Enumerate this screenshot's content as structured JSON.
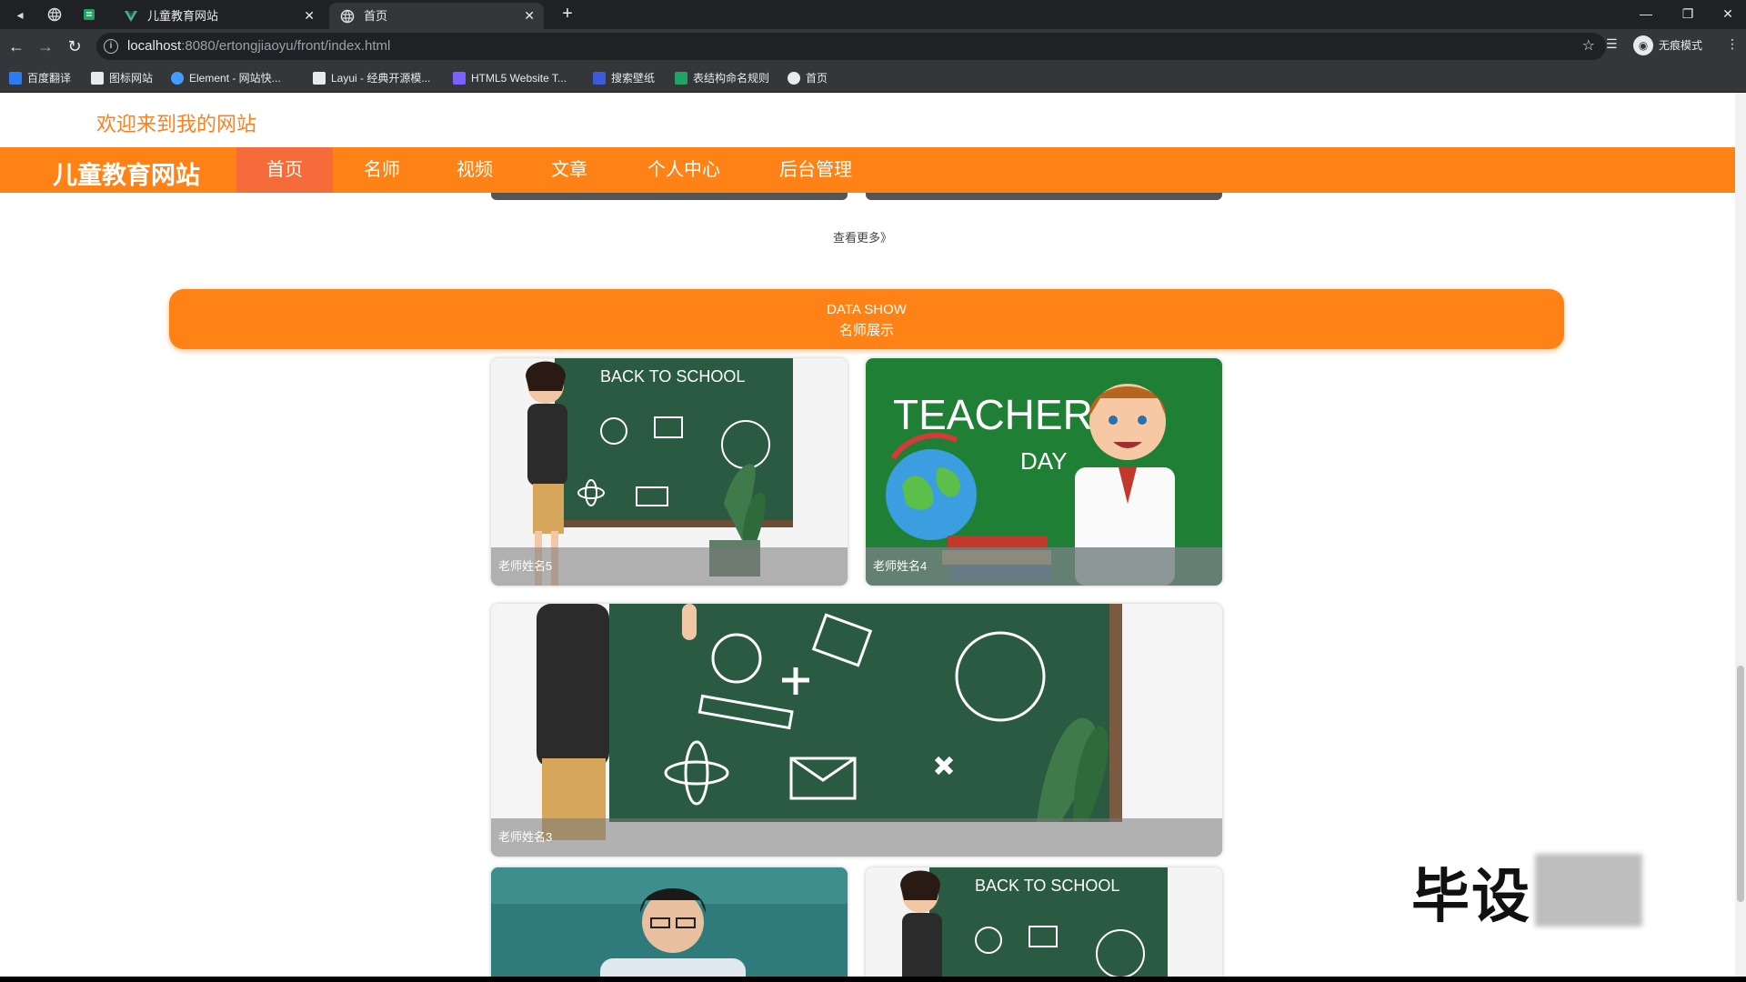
{
  "browser": {
    "tabs": [
      {
        "title": "儿童教育网站",
        "active": false
      },
      {
        "title": "首页",
        "active": true
      }
    ],
    "url_host": "localhost",
    "url_rest": ":8080/ertongjiaoyu/front/index.html",
    "profile_label": "无痕模式",
    "bookmarks": [
      {
        "label": "百度翻译",
        "color": "#2d7bf4"
      },
      {
        "label": "图标网站",
        "color": "#e8eaed"
      },
      {
        "label": "Element - 网站快...",
        "color": "#409eff"
      },
      {
        "label": "Layui - 经典开源模...",
        "color": "#e8eaed"
      },
      {
        "label": "HTML5 Website T...",
        "color": "#7b61ff"
      },
      {
        "label": "搜索壁纸",
        "color": "#3b5bdb"
      },
      {
        "label": "表结构命名规则",
        "color": "#21a366"
      },
      {
        "label": "首页",
        "color": "#e8eaed"
      }
    ]
  },
  "site": {
    "welcome": "欢迎来到我的网站",
    "brand": "儿童教育网站",
    "nav": [
      "首页",
      "名师",
      "视频",
      "文章",
      "个人中心",
      "后台管理"
    ],
    "more_link": "查看更多》",
    "section": {
      "en": "DATA SHOW",
      "cn": "名师展示"
    },
    "teachers": [
      {
        "name": "老师姓名5"
      },
      {
        "name": "老师姓名4"
      },
      {
        "name": "老师姓名3"
      }
    ],
    "card_texts": {
      "back_to_school": "BACK TO SCHOOL",
      "teachers": "TEACHER'S",
      "day": "DAY"
    }
  },
  "watermark": "毕设",
  "colors": {
    "accent": "#ff8216",
    "nav_active": "#f56b3a",
    "welcome": "#ff7f1e"
  }
}
